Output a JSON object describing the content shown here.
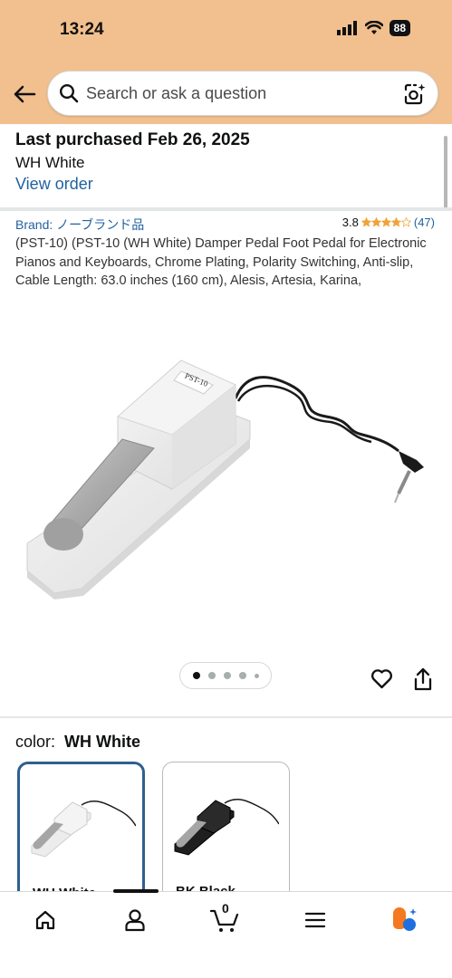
{
  "status_bar": {
    "time": "13:24",
    "battery": "88"
  },
  "search": {
    "placeholder": "Search or ask a question"
  },
  "purchase": {
    "title": "Last purchased Feb 26, 2025",
    "color": "WH White",
    "view_order": "View order"
  },
  "product": {
    "brand": "Brand: ノーブランド品",
    "rating": "3.8",
    "rating_count": "(47)",
    "stars": 3.8,
    "title": "(PST-10) (PST-10 (WH White) Damper Pedal Foot Pedal for Electronic Pianos and Keyboards, Chrome Plating, Polarity Switching, Anti-slip, Cable Length: 63.0 inches (160 cm), Alesis, Artesia, Karina,",
    "image_label": "PST-10"
  },
  "carousel": {
    "total": 5,
    "active": 1
  },
  "color_selection": {
    "label": "color:",
    "selected": "WH White",
    "options": [
      {
        "label": "WH White"
      },
      {
        "label": "BK Black"
      }
    ]
  },
  "nav": {
    "cart_count": "0"
  },
  "colors": {
    "header_bg": "#f2c08e",
    "link": "#2162a1",
    "star": "#f1a33b",
    "selected_border": "#2f5f8f"
  }
}
